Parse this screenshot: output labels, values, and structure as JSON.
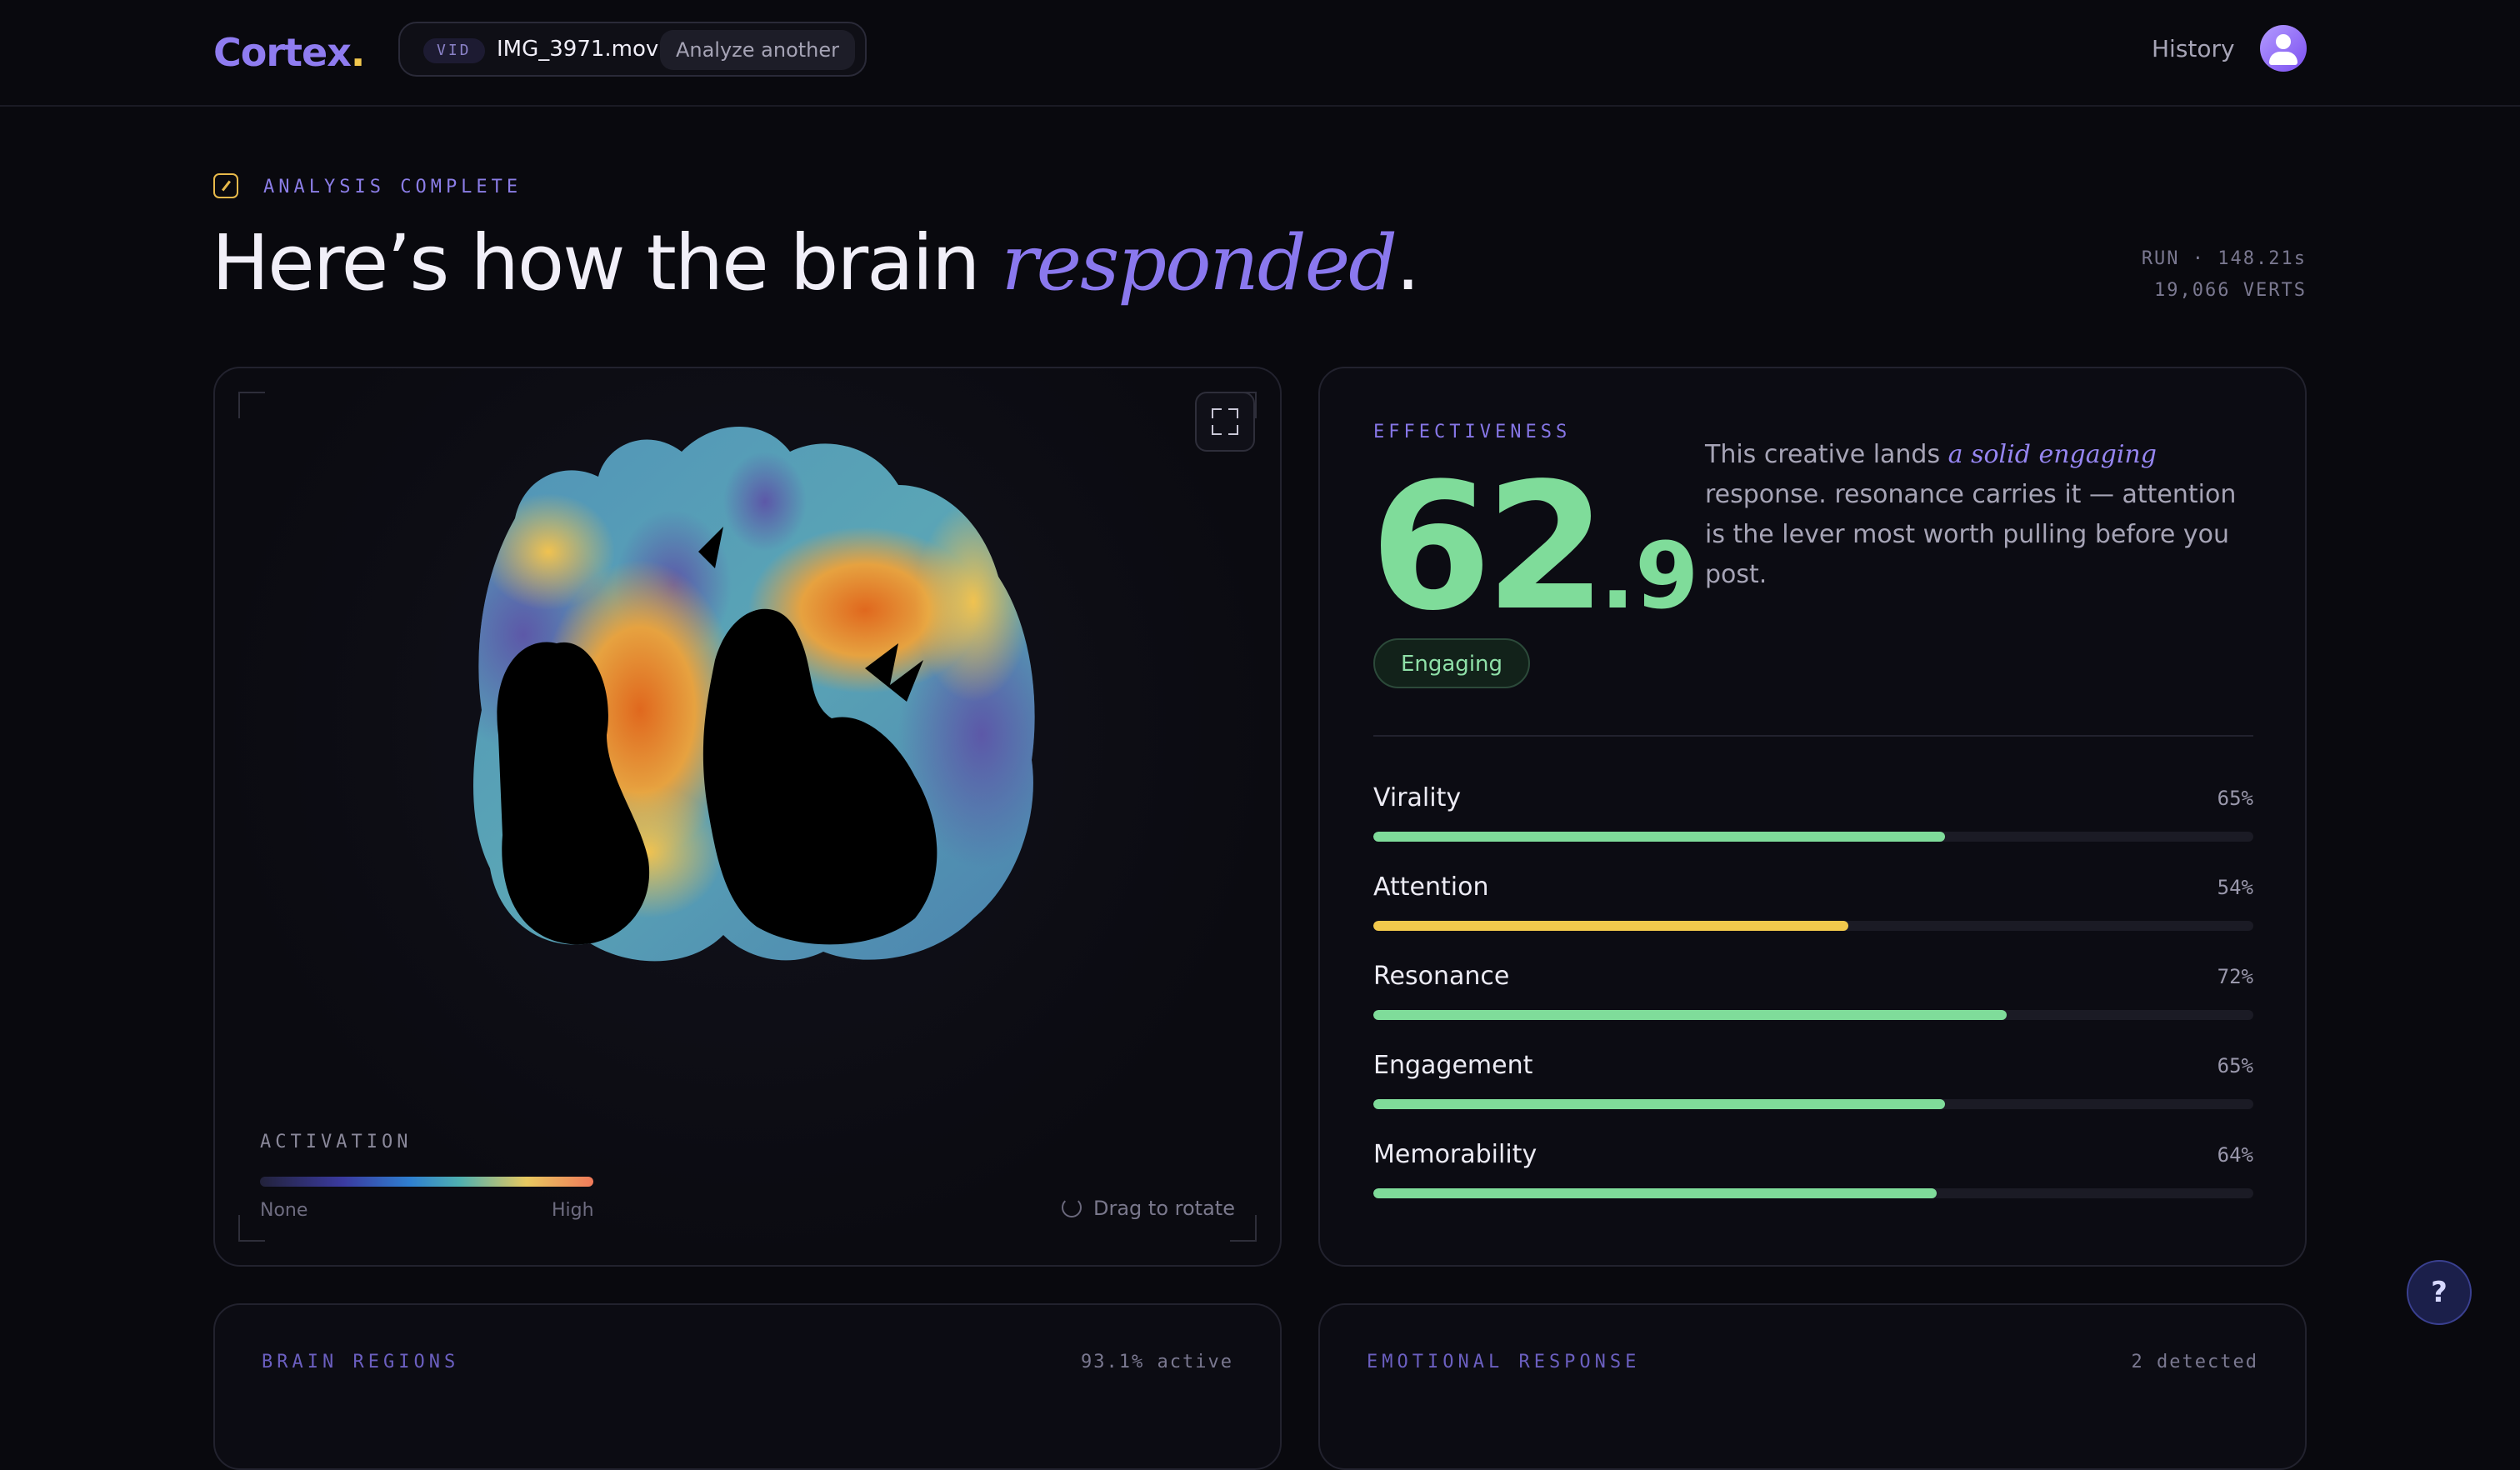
{
  "header": {
    "logo": "Cortex",
    "logo_dot": ".",
    "file_badge": "VID",
    "file_name": "IMG_3971.mov",
    "analyze_label": "Analyze another",
    "history_label": "History"
  },
  "hero": {
    "status": "ANALYSIS COMPLETE",
    "headline_start": "Here’s how the brain ",
    "headline_em": "responded",
    "headline_end": ".",
    "run_line": "RUN · 148.21s",
    "verts_line": "19,066 VERTS"
  },
  "brain_view": {
    "legend_title": "ACTIVATION",
    "legend_low": "None",
    "legend_high": "High",
    "drag_hint": "Drag to rotate"
  },
  "effectiveness": {
    "label": "EFFECTIVENESS",
    "score_int": "62",
    "score_dec": ".9",
    "tag": "Engaging",
    "summary_start": "This creative lands ",
    "summary_em": "a solid engaging",
    "summary_end": " response. resonance carries it — attention is the lever most worth pulling before you post.",
    "metrics": [
      {
        "name": "Virality",
        "value_label": "65%",
        "value": 65,
        "color": "#7fdc9a"
      },
      {
        "name": "Attention",
        "value_label": "54%",
        "value": 54,
        "color": "#f2c94c"
      },
      {
        "name": "Resonance",
        "value_label": "72%",
        "value": 72,
        "color": "#7fdc9a"
      },
      {
        "name": "Engagement",
        "value_label": "65%",
        "value": 65,
        "color": "#7fdc9a"
      },
      {
        "name": "Memorability",
        "value_label": "64%",
        "value": 64,
        "color": "#7fdc9a"
      }
    ]
  },
  "brain_regions": {
    "label": "BRAIN REGIONS",
    "meta": "93.1% active"
  },
  "emotional_response": {
    "label": "EMOTIONAL RESPONSE",
    "meta": "2 detected"
  },
  "help_label": "?",
  "colors": {
    "accent": "#8a78ee",
    "score": "#7fdc9a",
    "attention": "#f2c94c",
    "background": "#09090e"
  }
}
